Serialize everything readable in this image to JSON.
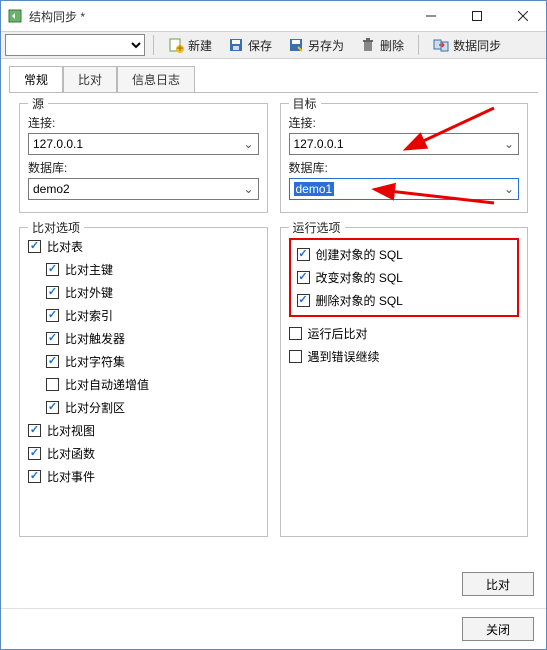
{
  "window": {
    "title": "结构同步 *"
  },
  "toolbar": {
    "new_label": "新建",
    "save_label": "保存",
    "save_as_label": "另存为",
    "delete_label": "删除",
    "sync_label": "数据同步"
  },
  "tabs": {
    "general": "常规",
    "compare": "比对",
    "log": "信息日志"
  },
  "source": {
    "group_title": "源",
    "connection_label": "连接:",
    "connection_value": "127.0.0.1",
    "database_label": "数据库:",
    "database_value": "demo2"
  },
  "target": {
    "group_title": "目标",
    "connection_label": "连接:",
    "connection_value": "127.0.0.1",
    "database_label": "数据库:",
    "database_value": "demo1"
  },
  "compare_options": {
    "group_title": "比对选项",
    "items": [
      {
        "label": "比对表",
        "checked": true,
        "indent": 0
      },
      {
        "label": "比对主键",
        "checked": true,
        "indent": 1
      },
      {
        "label": "比对外键",
        "checked": true,
        "indent": 1
      },
      {
        "label": "比对索引",
        "checked": true,
        "indent": 1
      },
      {
        "label": "比对触发器",
        "checked": true,
        "indent": 1
      },
      {
        "label": "比对字符集",
        "checked": true,
        "indent": 1
      },
      {
        "label": "比对自动递增值",
        "checked": false,
        "indent": 1
      },
      {
        "label": "比对分割区",
        "checked": true,
        "indent": 1
      },
      {
        "label": "比对视图",
        "checked": true,
        "indent": 0
      },
      {
        "label": "比对函数",
        "checked": true,
        "indent": 0
      },
      {
        "label": "比对事件",
        "checked": true,
        "indent": 0
      }
    ]
  },
  "run_options": {
    "group_title": "运行选项",
    "highlighted": [
      {
        "label": "创建对象的 SQL",
        "checked": true
      },
      {
        "label": "改变对象的 SQL",
        "checked": true
      },
      {
        "label": "删除对象的 SQL",
        "checked": true
      }
    ],
    "others": [
      {
        "label": "运行后比对",
        "checked": false
      },
      {
        "label": "遇到错误继续",
        "checked": false
      }
    ]
  },
  "footer": {
    "compare_btn": "比对",
    "close_btn": "关闭"
  },
  "colors": {
    "accent": "#2a6fd6",
    "highlight_red": "#e60000"
  }
}
